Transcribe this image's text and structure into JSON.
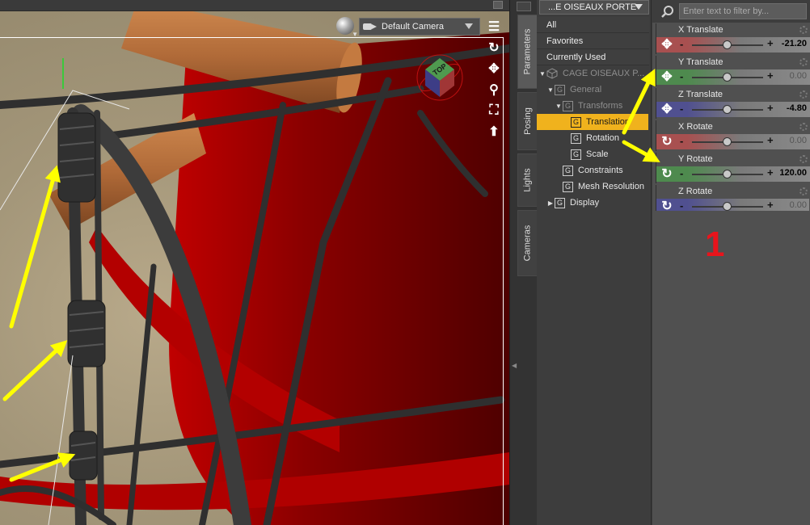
{
  "viewport": {
    "camera_label": "Default Camera",
    "nav_cube_label": "TOP",
    "nav_tools": [
      "orbit-icon",
      "pan-icon",
      "zoom-icon",
      "frame-icon",
      "reset-icon"
    ]
  },
  "side_tabs": [
    {
      "label": "Parameters",
      "active": true
    },
    {
      "label": "Posing",
      "active": false
    },
    {
      "label": "Lights",
      "active": false
    },
    {
      "label": "Cameras",
      "active": false
    }
  ],
  "node_panel": {
    "selected_node": "...E OISEAUX PORTE",
    "categories": [
      "All",
      "Favorites",
      "Currently Used"
    ],
    "tree": [
      {
        "label": "CAGE OISEAUX P...",
        "icon": "cube-icon",
        "dim": true
      },
      {
        "label": "General",
        "icon": "group-icon",
        "dim": true
      },
      {
        "label": "Transforms",
        "icon": "group-icon",
        "dim": true
      },
      {
        "label": "Translation",
        "icon": "group-icon",
        "selected": true
      },
      {
        "label": "Rotation",
        "icon": "group-icon"
      },
      {
        "label": "Scale",
        "icon": "group-icon"
      },
      {
        "label": "Constraints",
        "icon": "group-icon"
      },
      {
        "label": "Mesh Resolution",
        "icon": "group-icon"
      },
      {
        "label": "Display",
        "icon": "group-icon"
      }
    ]
  },
  "param_panel": {
    "filter_placeholder": "Enter text to filter by...",
    "params": [
      {
        "name": "X Translate",
        "value": "-21.20",
        "slider": 0.5,
        "bold": true,
        "color": "#a85050",
        "icon": "move-icon"
      },
      {
        "name": "Y Translate",
        "value": "0.00",
        "slider": 0.5,
        "bold": false,
        "color": "#4e8a4e",
        "icon": "move-icon"
      },
      {
        "name": "Z Translate",
        "value": "-4.80",
        "slider": 0.5,
        "bold": true,
        "color": "#505090",
        "icon": "move-icon"
      },
      {
        "name": "X Rotate",
        "value": "0.00",
        "slider": 0.5,
        "bold": false,
        "color": "#a85050",
        "icon": "rotate-icon"
      },
      {
        "name": "Y Rotate",
        "value": "120.00",
        "slider": 0.5,
        "bold": true,
        "color": "#4e8a4e",
        "icon": "rotate-icon"
      },
      {
        "name": "Z Rotate",
        "value": "0.00",
        "slider": 0.5,
        "bold": false,
        "color": "#505090",
        "icon": "rotate-icon"
      }
    ]
  },
  "annotation_number": "1",
  "colors": {
    "highlight": "#f0b21d",
    "annotation_arrow": "#ffff00",
    "annotation_number": "#e8141c"
  }
}
